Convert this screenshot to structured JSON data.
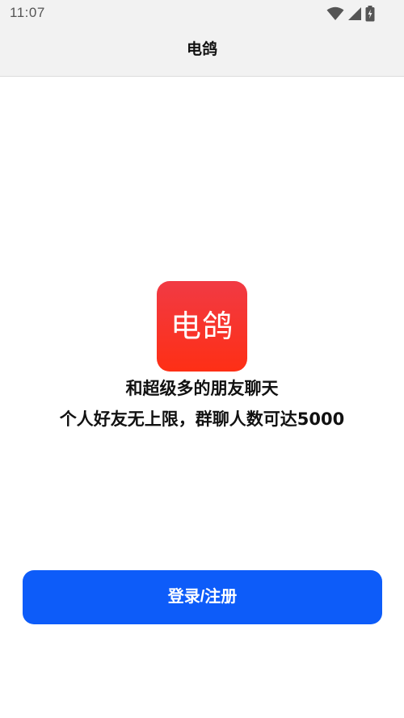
{
  "status_bar": {
    "time": "11:07",
    "icons": [
      "wifi-icon",
      "cellular-signal-icon",
      "battery-charging-icon"
    ]
  },
  "header": {
    "title": "电鸽"
  },
  "main": {
    "logo_text": "电鸽",
    "tagline_line1": "和超级多的朋友聊天",
    "tagline_line2": "个人好友无上限，群聊人数可达5000",
    "login_button_label": "登录/注册"
  },
  "colors": {
    "accent_button": "#0d5cf9",
    "logo_red_top": "#f13a44",
    "logo_red_bottom": "#fe2f15",
    "header_background": "#f2f2f2"
  }
}
